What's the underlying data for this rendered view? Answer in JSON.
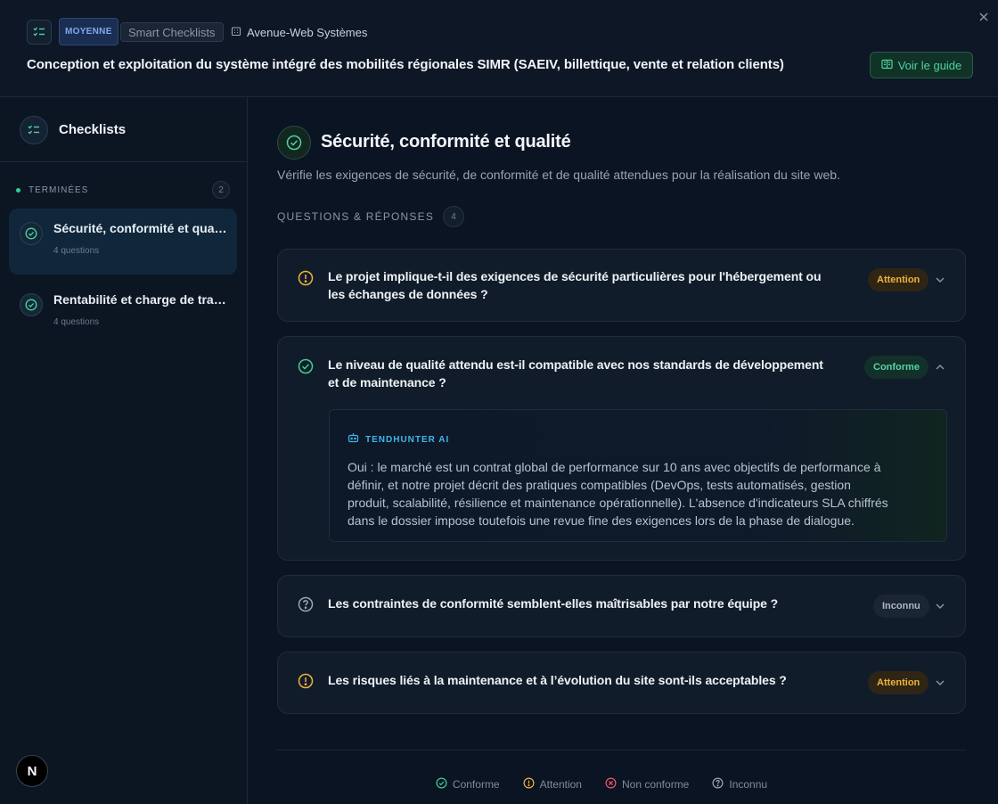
{
  "header": {
    "level_badge": "MOYENNE",
    "tool_badge": "Smart Checklists",
    "company": "Avenue-Web Systèmes",
    "title": "Conception et exploitation du système intégré des mobilités régionales SIMR (SAEIV, billettique, vente et relation clients)",
    "guide_button": "Voir le guide",
    "icons": {
      "list": "checklist-icon",
      "company": "building-icon",
      "guide": "book-icon",
      "close": "close-icon"
    }
  },
  "sidebar": {
    "title": "Checklists",
    "group": {
      "label": "TERMINÉES",
      "count": "2"
    },
    "items": [
      {
        "title": "Sécurité, conformité et qualité",
        "subtitle": "4 questions",
        "active": true
      },
      {
        "title": "Rentabilité et charge de travail",
        "subtitle": "4 questions",
        "active": false
      }
    ],
    "avatar": "N"
  },
  "main": {
    "title": "Sécurité, conformité et qualité",
    "description": "Vérifie les exigences de sécurité, de conformité et de qualité attendues pour la réalisation du site web.",
    "qa_label": "QUESTIONS & RÉPONSES",
    "qa_count": "4",
    "questions": [
      {
        "line1": "Le projet implique-t-il des exigences de sécurité particulières pour l'hébergement ou",
        "line2": "les échanges de données ?",
        "status": "Attention",
        "status_icon": "warning-icon",
        "expanded": false
      },
      {
        "line1": "Le niveau de qualité attendu est-il compatible avec nos standards de développement",
        "line2": "et de maintenance ?",
        "status": "Conforme",
        "status_icon": "check-circle-icon",
        "expanded": true,
        "ai_label": "TENDHUNTER AI",
        "ai_lines": [
          "Oui : le marché est un contrat global de performance sur 10 ans avec objectifs de performance à",
          "définir, et notre projet décrit des pratiques compatibles (DevOps, tests automatisés, gestion",
          "produit, scalabilité, résilience et maintenance opérationnelle). L'absence d'indicateurs SLA chiffrés",
          "dans le dossier impose toutefois une revue fine des exigences lors de la phase de dialogue."
        ]
      },
      {
        "line1": "Les contraintes de conformité semblent-elles maîtrisables par notre équipe ?",
        "status": "Inconnu",
        "status_icon": "question-icon",
        "expanded": false
      },
      {
        "line1": "Les risques liés à la maintenance et à l’évolution du site sont-ils acceptables ?",
        "status": "Attention",
        "status_icon": "warning-icon",
        "expanded": false
      }
    ]
  },
  "legend": [
    {
      "label": "Conforme",
      "color": "#3fcf95",
      "icon": "check-circle-icon"
    },
    {
      "label": "Attention",
      "color": "#f0b23a",
      "icon": "warning-icon"
    },
    {
      "label": "Non conforme",
      "color": "#f0566a",
      "icon": "x-circle-icon"
    },
    {
      "label": "Inconnu",
      "color": "#9aa6b4",
      "icon": "question-icon"
    }
  ],
  "colors": {
    "accent_green": "#4fd2a0",
    "warning": "#f0b23a",
    "background": "#0b1422"
  }
}
